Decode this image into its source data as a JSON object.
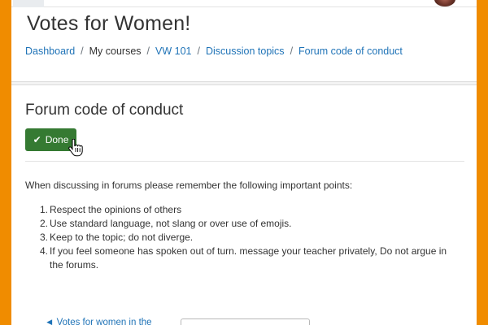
{
  "site": {
    "title": "Votes for Women!"
  },
  "breadcrumb": {
    "items": [
      {
        "label": "Dashboard",
        "link": true
      },
      {
        "label": "My courses",
        "link": false
      },
      {
        "label": "VW 101",
        "link": true
      },
      {
        "label": "Discussion topics",
        "link": true
      },
      {
        "label": "Forum code of conduct",
        "link": true
      }
    ],
    "separator": "/"
  },
  "page": {
    "title": "Forum code of conduct",
    "done_label": "Done",
    "intro": "When discussing in forums please remember the following important points:",
    "points": [
      {
        "num": "1.",
        "text": "Respect the opinions of others"
      },
      {
        "num": "2.",
        "text": "Use standard language, not slang or over use of emojis."
      },
      {
        "num": "3.",
        "text": "Keep to the topic; do not diverge."
      },
      {
        "num": "4.",
        "text": "If you feel someone has spoken out of turn. message your teacher privately, Do not argue in the forums."
      }
    ]
  },
  "nav": {
    "previous_label": "◄ Votes for women in the"
  },
  "colors": {
    "accent": "#f08c00",
    "done_button": "#357a32",
    "link": "#1f73b7"
  }
}
